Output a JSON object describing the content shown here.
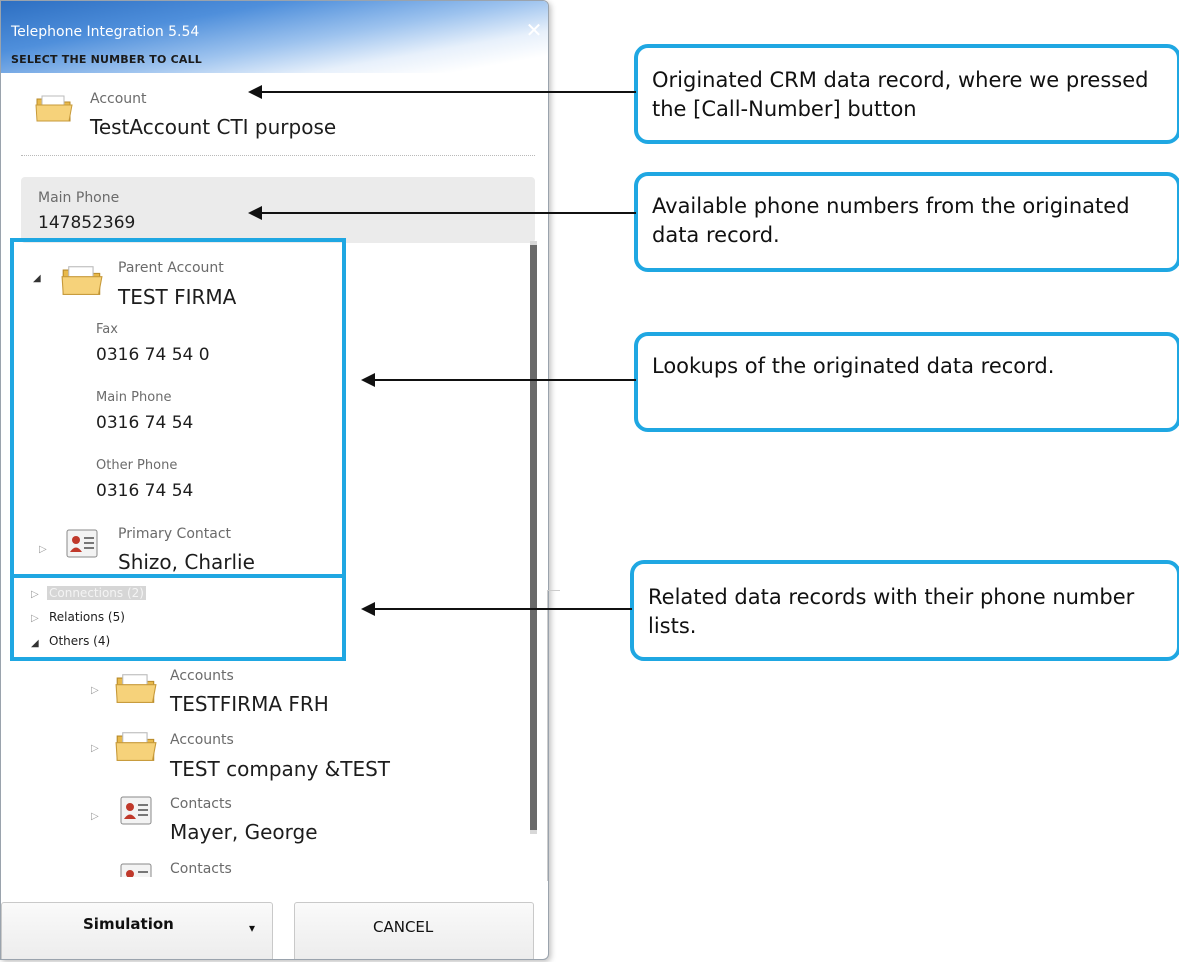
{
  "window": {
    "title": "Telephone Integration 5.54",
    "close_glyph": "✕",
    "subtitle": "SELECT THE NUMBER TO CALL"
  },
  "origin": {
    "entity_label": "Account",
    "entity_name": "TestAccount CTI purpose",
    "phone_label": "Main Phone",
    "phone_value": "147852369"
  },
  "lookups": {
    "parent": {
      "label": "Parent Account",
      "name": "TEST FIRMA",
      "phones": [
        {
          "label": "Fax",
          "value": "0316 74 54 0"
        },
        {
          "label": "Main Phone",
          "value": "0316 74 54"
        },
        {
          "label": "Other Phone",
          "value": "0316 74 54"
        }
      ]
    },
    "primary_contact": {
      "label": "Primary Contact",
      "name": "Shizo, Charlie"
    }
  },
  "related": {
    "groups": [
      {
        "label": "Connections (2)",
        "expanded": false,
        "highlighted": true
      },
      {
        "label": "Relations (5)",
        "expanded": false
      },
      {
        "label": "Others (4)",
        "expanded": true
      }
    ],
    "others": [
      {
        "type": "Accounts",
        "name": "TESTFIRMA FRH",
        "icon": "folder-icon"
      },
      {
        "type": "Accounts",
        "name": "TEST company &TEST",
        "icon": "folder-icon"
      },
      {
        "type": "Contacts",
        "name": "Mayer, George",
        "icon": "contact-card-icon"
      },
      {
        "type": "Contacts",
        "name": "",
        "icon": "contact-card-icon"
      }
    ]
  },
  "buttons": {
    "simulation": "Simulation",
    "dropdown_glyph": "▾",
    "cancel": "CANCEL"
  },
  "callouts": [
    "Originated CRM data record, where we pressed the [Call-Number] button",
    "Available phone numbers from the originated data record.",
    "Lookups of the originated data record.",
    "Related data records with their phone number lists."
  ],
  "colors": {
    "highlight_frame": "#1fa7e2",
    "titlebar_blue": "#2d6fc2"
  }
}
